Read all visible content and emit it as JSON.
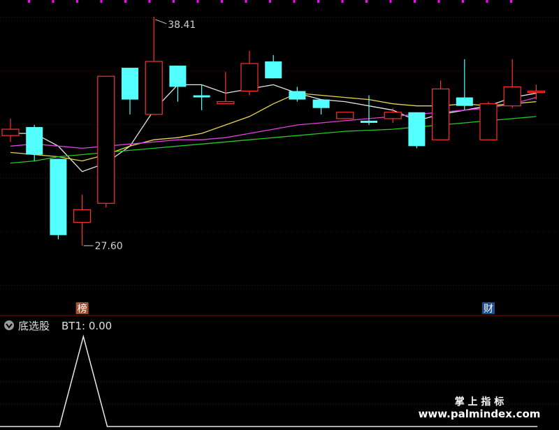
{
  "chart_data": [
    {
      "type": "candlestick",
      "price_range": [
        24.5,
        39.2
      ],
      "grid": true,
      "candles": [
        {
          "o": 33.1,
          "c": 32.8,
          "h": 33.6,
          "l": 32.5,
          "dir": "up"
        },
        {
          "o": 33.2,
          "c": 31.9,
          "h": 33.3,
          "l": 31.6,
          "dir": "down"
        },
        {
          "o": 31.7,
          "c": 28.1,
          "h": 31.7,
          "l": 27.9,
          "dir": "down"
        },
        {
          "o": 28.7,
          "c": 29.3,
          "h": 30.0,
          "l": 27.6,
          "dir": "up"
        },
        {
          "o": 29.6,
          "c": 35.6,
          "h": 35.6,
          "l": 29.4,
          "dir": "up"
        },
        {
          "o": 36.0,
          "c": 34.5,
          "h": 36.0,
          "l": 33.8,
          "dir": "down"
        },
        {
          "o": 33.8,
          "c": 36.3,
          "h": 38.41,
          "l": 33.8,
          "dir": "up"
        },
        {
          "o": 36.1,
          "c": 35.1,
          "h": 36.1,
          "l": 34.4,
          "dir": "down"
        },
        {
          "o": 34.7,
          "c": 34.6,
          "h": 35.2,
          "l": 34.0,
          "dir": "down"
        },
        {
          "o": 34.3,
          "c": 34.4,
          "h": 35.8,
          "l": 34.3,
          "dir": "up"
        },
        {
          "o": 34.9,
          "c": 36.2,
          "h": 36.8,
          "l": 34.7,
          "dir": "up"
        },
        {
          "o": 36.3,
          "c": 35.5,
          "h": 36.6,
          "l": 35.5,
          "dir": "down"
        },
        {
          "o": 34.9,
          "c": 34.5,
          "h": 35.1,
          "l": 34.4,
          "dir": "down"
        },
        {
          "o": 34.5,
          "c": 34.1,
          "h": 34.5,
          "l": 33.8,
          "dir": "down"
        },
        {
          "o": 33.6,
          "c": 33.9,
          "h": 33.9,
          "l": 33.6,
          "dir": "up"
        },
        {
          "o": 33.5,
          "c": 33.4,
          "h": 34.7,
          "l": 33.3,
          "dir": "down"
        },
        {
          "o": 33.6,
          "c": 33.9,
          "h": 34.1,
          "l": 33.4,
          "dir": "up"
        },
        {
          "o": 33.9,
          "c": 32.3,
          "h": 33.9,
          "l": 32.2,
          "dir": "down"
        },
        {
          "o": 32.6,
          "c": 35.0,
          "h": 35.4,
          "l": 32.6,
          "dir": "up"
        },
        {
          "o": 34.6,
          "c": 34.2,
          "h": 36.4,
          "l": 34.0,
          "dir": "down"
        },
        {
          "o": 32.6,
          "c": 34.3,
          "h": 34.4,
          "l": 32.6,
          "dir": "up"
        },
        {
          "o": 34.2,
          "c": 35.1,
          "h": 36.4,
          "l": 34.1,
          "dir": "up"
        },
        {
          "o": 34.9,
          "c": 34.9,
          "h": 35.2,
          "l": 34.5,
          "dir": "up"
        }
      ],
      "ma_lines": [
        {
          "color": "#e6e6e6",
          "values": [
            32.9,
            32.9,
            32.3,
            31.1,
            31.5,
            32.3,
            34.0,
            35.2,
            35.2,
            34.8,
            35.0,
            35.2,
            34.8,
            34.5,
            34.4,
            34.2,
            34.0,
            33.5,
            33.8,
            34.0,
            34.2,
            34.6,
            34.8
          ]
        },
        {
          "color": "#e8d44d",
          "values": [
            32.0,
            31.9,
            31.8,
            31.6,
            31.9,
            32.3,
            32.6,
            32.7,
            32.9,
            33.3,
            33.7,
            34.3,
            34.8,
            34.7,
            34.6,
            34.5,
            34.3,
            34.2,
            34.2,
            34.3,
            34.2,
            34.3,
            34.4
          ]
        },
        {
          "color": "#e040e0",
          "values": [
            32.3,
            32.4,
            32.3,
            32.2,
            32.3,
            32.4,
            32.5,
            32.6,
            32.6,
            32.7,
            32.9,
            33.1,
            33.3,
            33.4,
            33.5,
            33.6,
            33.7,
            33.8,
            33.9,
            34.0,
            34.1,
            34.3,
            34.6
          ]
        },
        {
          "color": "#22cc22",
          "values": [
            31.5,
            31.6,
            31.8,
            31.9,
            32.0,
            32.1,
            32.2,
            32.3,
            32.4,
            32.5,
            32.6,
            32.7,
            32.8,
            32.9,
            33.0,
            33.05,
            33.1,
            33.2,
            33.3,
            33.4,
            33.5,
            33.6,
            33.7
          ]
        }
      ],
      "high_label": "38.41",
      "low_label": "27.60",
      "markers": [
        {
          "candle": 3,
          "text": "榜",
          "bg": "#a0522d"
        },
        {
          "candle": 20,
          "text": "财",
          "bg": "#1f4f8f"
        }
      ]
    },
    {
      "type": "line",
      "indicator_name": "底选股",
      "series": [
        {
          "name": "BT1",
          "value_label": "0.00",
          "values": [
            0,
            0,
            0,
            0,
            1,
            0,
            0,
            0,
            0,
            0,
            0,
            0,
            0,
            0,
            0,
            0,
            0,
            0,
            0,
            0,
            0,
            0,
            0,
            0
          ]
        }
      ],
      "ylim": [
        0,
        1
      ]
    }
  ],
  "indicator_panel": {
    "icon": "chevron-down-icon",
    "name": "底选股",
    "series_label": "BT1: 0.00"
  },
  "watermark": {
    "top": "掌 上 指 标",
    "bottom": "www.palmindex.com"
  },
  "colors": {
    "up": "#ff3030",
    "down": "#54ffff",
    "grid": "#6e0000",
    "top_tick": "#ff00ff"
  }
}
